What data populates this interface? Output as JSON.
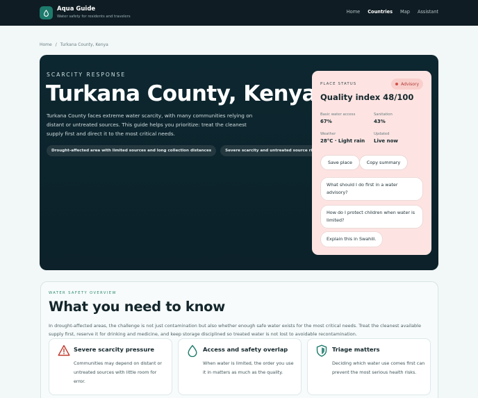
{
  "header": {
    "brand_name": "Aqua Guide",
    "brand_tagline": "Water safety for residents and travelers",
    "logo_icon": "water-drop-icon",
    "nav": [
      "Home",
      "Countries",
      "Map",
      "Assistant"
    ],
    "active_nav": "Countries"
  },
  "breadcrumb": {
    "home": "Home",
    "separator": "/",
    "current": "Turkana County, Kenya"
  },
  "hero": {
    "eyebrow": "SCARCITY RESPONSE",
    "title": "Turkana County, Kenya",
    "description": "Turkana County faces extreme water scarcity, with many communities relying on distant or untreated sources. This guide helps you prioritize: treat the cleanest supply first and direct it to the most critical needs.",
    "chips": [
      "Drought-affected area with limited sources and long collection distances",
      "Severe scarcity and untreated source risk"
    ]
  },
  "status": {
    "label": "PLACE STATUS",
    "badge": "Advisory",
    "quality": "Quality index 48/100",
    "stats": [
      {
        "key": "Basic water access",
        "value": "67%"
      },
      {
        "key": "Sanitation",
        "value": "43%"
      },
      {
        "key": "Weather",
        "value": "28°C · Light rain"
      },
      {
        "key": "Updated",
        "value": "Live now"
      }
    ],
    "buttons": {
      "save": "Save place",
      "copy": "Copy summary"
    },
    "prompts": [
      "What should I do first in a water advisory?",
      "How do I protect children when water is limited?",
      "Explain this in Swahili."
    ]
  },
  "overview": {
    "eyebrow": "WATER SAFETY OVERVIEW",
    "title": "What you need to know",
    "description": "In drought-affected areas, the challenge is not just contamination but also whether enough safe water exists for the most critical needs. Treat the cleanest available supply first, reserve it for drinking and medicine, and keep storage disciplined so treated water is not lost to avoidable recontamination.",
    "features": [
      {
        "icon": "warning-triangle-icon",
        "title": "Severe scarcity pressure",
        "desc": "Communities may depend on distant or untreated sources with little room for error."
      },
      {
        "icon": "water-drop-icon",
        "title": "Access and safety overlap",
        "desc": "When water is limited, the order you use it in matters as much as the quality."
      },
      {
        "icon": "shield-icon",
        "title": "Triage matters",
        "desc": "Deciding which water use comes first can prevent the most serious health risks."
      }
    ]
  },
  "colors": {
    "topbar": "#0f1c23",
    "hero": "#0d2730",
    "status_card": "#fde4e2",
    "advisory": "#b13a34",
    "accent_green": "#2d8a6c"
  }
}
